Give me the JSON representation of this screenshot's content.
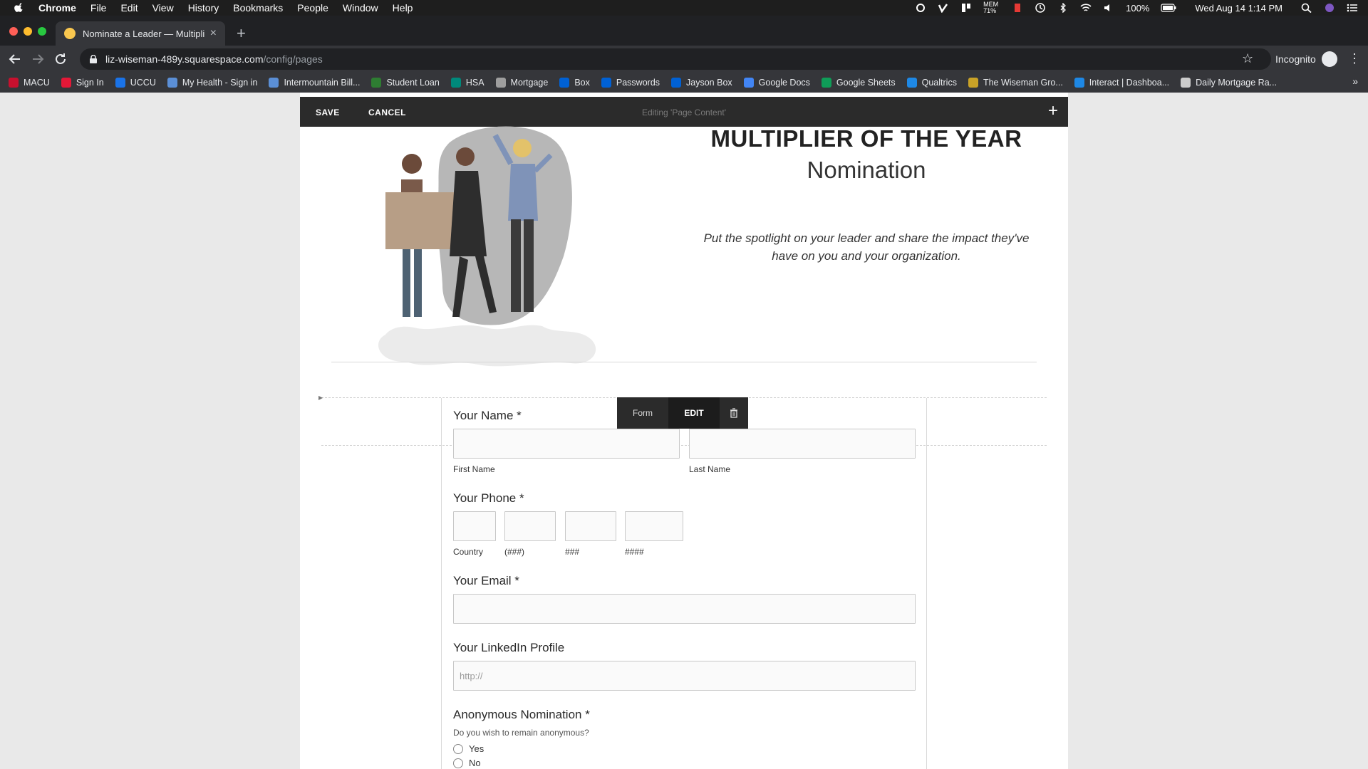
{
  "menubar": {
    "app": "Chrome",
    "items": [
      "File",
      "Edit",
      "View",
      "History",
      "Bookmarks",
      "People",
      "Window",
      "Help"
    ],
    "mem": "MEM 71%",
    "battery": "100%",
    "datetime": "Wed Aug 14  1:14 PM"
  },
  "tab": {
    "title": "Nominate a Leader — Multiplie",
    "close": "×",
    "new_tab": "+"
  },
  "toolbar": {
    "url_host": "liz-wiseman-489y.squarespace.com",
    "url_path": "/config/pages",
    "incognito": "Incognito"
  },
  "bookmarks": [
    {
      "label": "MACU",
      "color": "#c8102e"
    },
    {
      "label": "Sign In",
      "color": "#e31837"
    },
    {
      "label": "UCCU",
      "color": "#1a73e8"
    },
    {
      "label": "My Health - Sign in",
      "color": "#5b8fd6"
    },
    {
      "label": "Intermountain Bill...",
      "color": "#5b8fd6"
    },
    {
      "label": "Student Loan",
      "color": "#2e7d32"
    },
    {
      "label": "HSA",
      "color": "#00897b"
    },
    {
      "label": "Mortgage",
      "color": "#9e9e9e"
    },
    {
      "label": "Box",
      "color": "#0061d5"
    },
    {
      "label": "Passwords",
      "color": "#0061d5"
    },
    {
      "label": "Jayson Box",
      "color": "#0061d5"
    },
    {
      "label": "Google Docs",
      "color": "#4285f4"
    },
    {
      "label": "Google Sheets",
      "color": "#0f9d58"
    },
    {
      "label": "Qualtrics",
      "color": "#1e88e5"
    },
    {
      "label": "The Wiseman Gro...",
      "color": "#c9a227"
    },
    {
      "label": "Interact | Dashboa...",
      "color": "#1e88e5"
    },
    {
      "label": "Daily Mortgage Ra...",
      "color": "#cccccc"
    }
  ],
  "bookmarks_more": "»",
  "editbar": {
    "save": "SAVE",
    "cancel": "CANCEL",
    "editing": "Editing 'Page Content'",
    "add": "+"
  },
  "hero": {
    "title": "MULTIPLIER OF THE YEAR",
    "subtitle": "Nomination",
    "description": "Put the spotlight on your leader and share the impact they've have on you and your organization."
  },
  "block_toolbar": {
    "form": "Form",
    "edit": "EDIT"
  },
  "form": {
    "name": {
      "label": "Your Name *",
      "first": "First Name",
      "last": "Last Name"
    },
    "phone": {
      "label": "Your Phone *",
      "country": "Country",
      "area": "(###)",
      "prefix": "###",
      "line": "####"
    },
    "email": {
      "label": "Your Email *"
    },
    "linkedin": {
      "label": "Your LinkedIn Profile",
      "placeholder": "http://"
    },
    "anonymous": {
      "label": "Anonymous Nomination *",
      "help": "Do you wish to remain anonymous?",
      "options": [
        "Yes",
        "No"
      ]
    }
  },
  "colors": {
    "editbar": "#2b2b2b",
    "page_bg": "#ffffff",
    "canvas_bg": "#e9e9e9"
  }
}
